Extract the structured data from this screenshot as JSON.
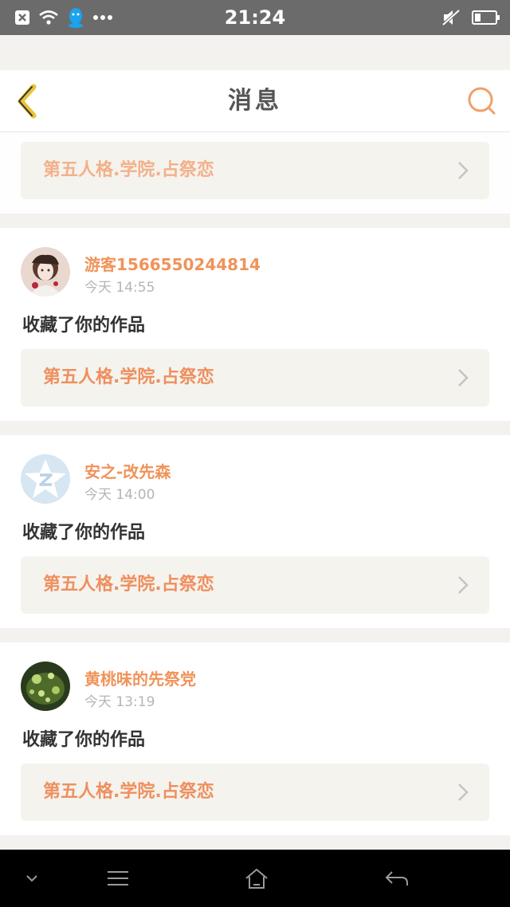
{
  "status_bar": {
    "time": "21:24",
    "left_icons": [
      "close-box-icon",
      "wifi-icon",
      "qq-penguin-icon",
      "more-dots-icon"
    ],
    "right_icons": [
      "mute-icon",
      "battery-icon"
    ]
  },
  "header": {
    "title": "消息",
    "back_icon": "chevron-left-icon",
    "search_icon": "search-icon"
  },
  "notifications": [
    {
      "partial": true,
      "work_title": "第五人格.学院.占祭恋"
    },
    {
      "user_name": "游客1566550244814",
      "time": "今天 14:55",
      "action": "收藏了你的作品",
      "work_title": "第五人格.学院.占祭恋",
      "avatar": "anime-girl-avatar"
    },
    {
      "user_name": "安之-改先森",
      "time": "今天 14:00",
      "action": "收藏了你的作品",
      "work_title": "第五人格.学院.占祭恋",
      "avatar": "qzone-star-avatar"
    },
    {
      "user_name": "黄桃味的先祭党",
      "time": "今天 13:19",
      "action": "收藏了你的作品",
      "work_title": "第五人格.学院.占祭恋",
      "avatar": "green-lights-avatar"
    }
  ],
  "colors": {
    "accent": "#f0935a",
    "back_arrow": "#e8c33a",
    "status_bar": "#6b6b6b",
    "page_background": "#f3f2ef"
  },
  "system_nav": {
    "buttons": [
      "chevron-down-icon",
      "menu-icon",
      "home-icon",
      "back-icon"
    ]
  }
}
